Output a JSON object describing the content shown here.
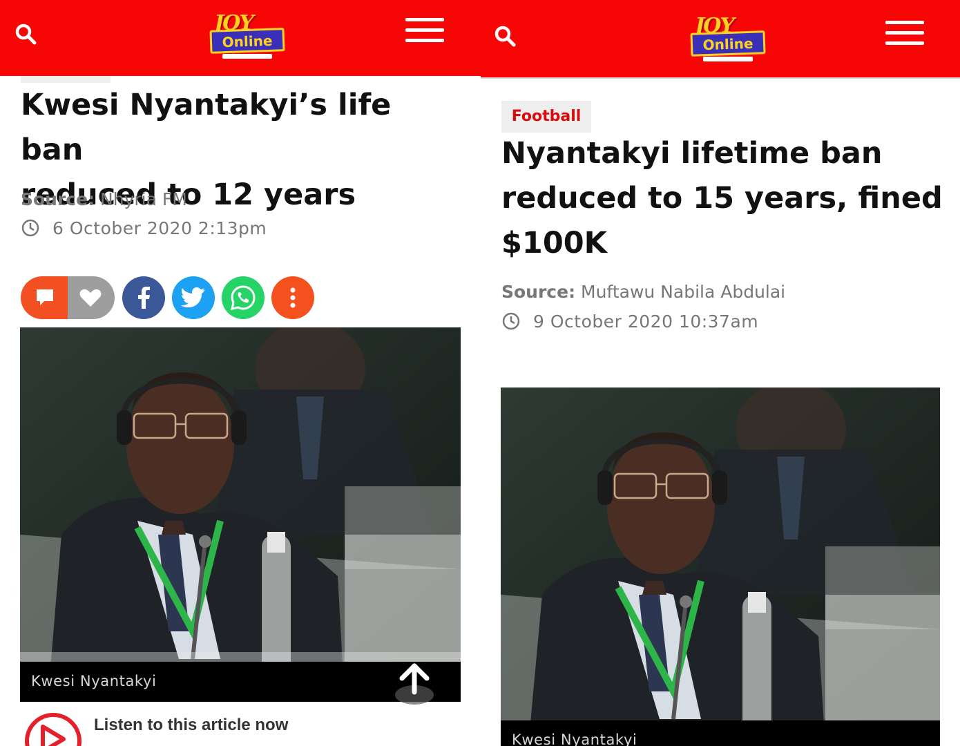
{
  "colors": {
    "brand_red": "#f70606",
    "tag_red": "#d90b0b",
    "comment_orange": "#f25022",
    "facebook_blue": "#3b5998",
    "twitter_blue": "#1da1f2",
    "whatsapp_green": "#25d366",
    "more_orange": "#f4511e"
  },
  "left": {
    "logo": {
      "top": "JOY",
      "main": "Online"
    },
    "headline_line1": "Kwesi Nyantakyi’s life ban",
    "headline_line2": "reduced to 12 years",
    "source_label": "Source:",
    "source_value": "Nhyria FM",
    "date": "6 October 2020 2:13pm",
    "share_buttons": [
      {
        "icon": "comment-icon"
      },
      {
        "icon": "heart-icon"
      },
      {
        "icon": "facebook-icon"
      },
      {
        "icon": "twitter-icon"
      },
      {
        "icon": "whatsapp-icon"
      },
      {
        "icon": "more-icon"
      }
    ],
    "photo_caption": "Kwesi Nyantakyi",
    "listen_label": "Listen to this article now"
  },
  "right": {
    "logo": {
      "top": "JOY",
      "main": "Online"
    },
    "category": "Football",
    "headline_line1": "Nyantakyi lifetime ban",
    "headline_line2": "reduced to 15 years, fined",
    "headline_line3": "$100K",
    "source_label": "Source:",
    "source_value": "Muftawu Nabila Abdulai",
    "date": "9 October 2020 10:37am",
    "photo_caption": "Kwesi Nyantakyi"
  }
}
